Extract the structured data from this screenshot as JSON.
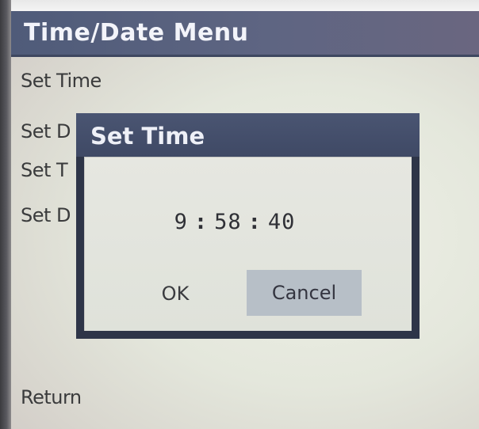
{
  "menu": {
    "title": "Time/Date Menu",
    "items": [
      "Set Time",
      "Set D",
      "Set T",
      "Set D"
    ],
    "return_label": "Return"
  },
  "dialog": {
    "title": "Set Time",
    "time": {
      "hours": "9",
      "minutes": "58",
      "seconds": "40",
      "separator": ":"
    },
    "ok_label": "OK",
    "cancel_label": "Cancel"
  },
  "colors": {
    "title_bar": "#56607d",
    "dialog_frame": "#2e3548",
    "cancel_highlight": "#b7bfc7"
  }
}
